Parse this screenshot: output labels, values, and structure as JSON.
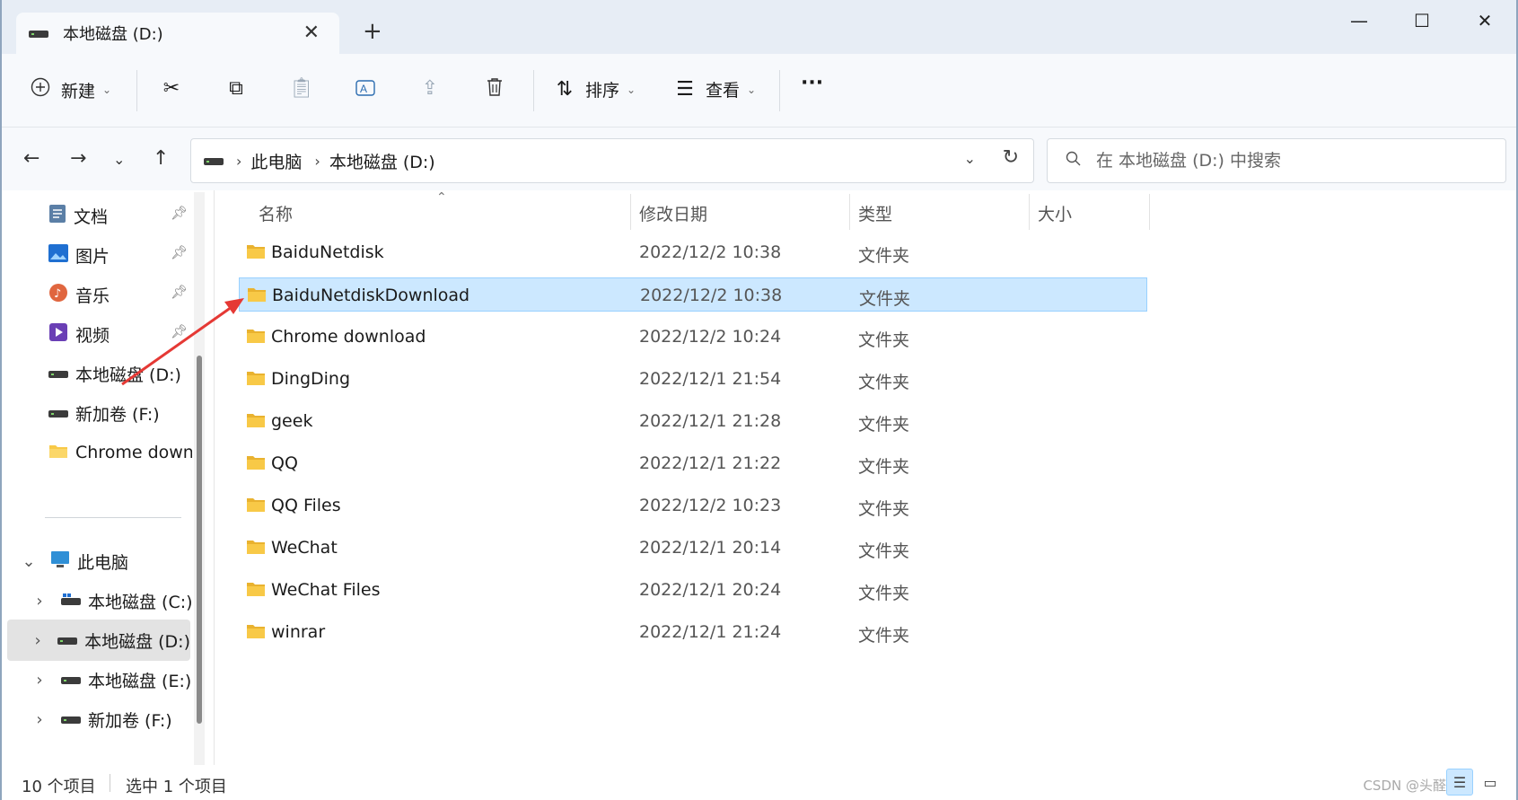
{
  "window": {
    "tab_title": "本地磁盘 (D:)",
    "tab_close_icon": "close-icon",
    "new_tab_label": "+",
    "controls": [
      "minimize-icon",
      "maximize-icon",
      "close-icon"
    ]
  },
  "toolbar": {
    "new_label": "新建",
    "sort_label": "排序",
    "view_label": "查看",
    "more_label": "···",
    "icons": [
      "cut-icon",
      "copy-icon",
      "paste-icon",
      "rename-icon",
      "share-icon",
      "delete-icon"
    ]
  },
  "address": {
    "crumbs": [
      "此电脑",
      "本地磁盘 (D:)"
    ],
    "search_placeholder": "在 本地磁盘 (D:) 中搜索"
  },
  "sidebar": {
    "quick_access": [
      {
        "label": "文档",
        "icon": "documents-icon",
        "pinned": true
      },
      {
        "label": "图片",
        "icon": "pictures-icon",
        "pinned": true
      },
      {
        "label": "音乐",
        "icon": "music-icon",
        "pinned": true
      },
      {
        "label": "视频",
        "icon": "videos-icon",
        "pinned": true
      },
      {
        "label": "本地磁盘 (D:)",
        "icon": "drive-icon",
        "pinned": false
      },
      {
        "label": "新加卷 (F:)",
        "icon": "drive-icon",
        "pinned": false
      },
      {
        "label": "Chrome downl",
        "icon": "folder-icon",
        "pinned": false
      }
    ],
    "this_pc": {
      "label": "此电脑",
      "expanded": true
    },
    "drives": [
      {
        "label": "本地磁盘 (C:)",
        "selected": false
      },
      {
        "label": "本地磁盘 (D:)",
        "selected": true
      },
      {
        "label": "本地磁盘 (E:)",
        "selected": false
      },
      {
        "label": "新加卷 (F:)",
        "selected": false
      }
    ]
  },
  "columns": {
    "name": "名称",
    "date": "修改日期",
    "type": "类型",
    "size": "大小"
  },
  "files": [
    {
      "name": "BaiduNetdisk",
      "date": "2022/12/2 10:38",
      "type": "文件夹",
      "selected": false
    },
    {
      "name": "BaiduNetdiskDownload",
      "date": "2022/12/2 10:38",
      "type": "文件夹",
      "selected": true
    },
    {
      "name": "Chrome download",
      "date": "2022/12/2 10:24",
      "type": "文件夹",
      "selected": false
    },
    {
      "name": "DingDing",
      "date": "2022/12/1 21:54",
      "type": "文件夹",
      "selected": false
    },
    {
      "name": "geek",
      "date": "2022/12/1 21:28",
      "type": "文件夹",
      "selected": false
    },
    {
      "name": "QQ",
      "date": "2022/12/1 21:22",
      "type": "文件夹",
      "selected": false
    },
    {
      "name": "QQ Files",
      "date": "2022/12/2 10:23",
      "type": "文件夹",
      "selected": false
    },
    {
      "name": "WeChat",
      "date": "2022/12/1 20:14",
      "type": "文件夹",
      "selected": false
    },
    {
      "name": "WeChat Files",
      "date": "2022/12/1 20:24",
      "type": "文件夹",
      "selected": false
    },
    {
      "name": "winrar",
      "date": "2022/12/1 21:24",
      "type": "文件夹",
      "selected": false
    }
  ],
  "status": {
    "count": "10 个项目",
    "selection": "选中 1 个项目",
    "watermark": "CSDN @头醛小弟"
  },
  "colors": {
    "selection_bg": "#cce8ff",
    "selection_border": "#99d1ff",
    "folder": "#f8c947",
    "annotation_arrow": "#e53935"
  }
}
